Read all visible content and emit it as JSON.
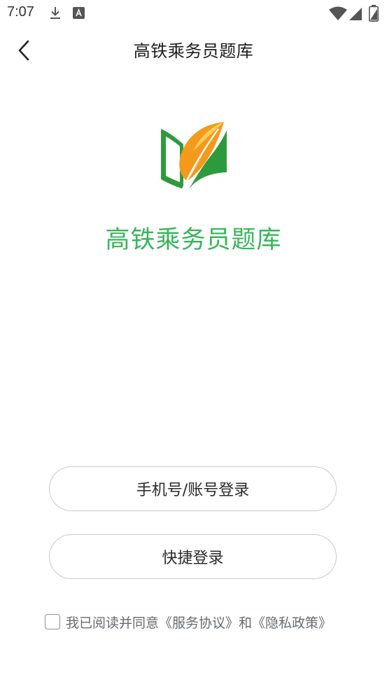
{
  "status_bar": {
    "time": "7:07",
    "icons": [
      "download-icon",
      "font-badge-icon",
      "wifi-icon",
      "signal-icon",
      "battery-icon"
    ]
  },
  "nav": {
    "back_icon": "chevron-left-icon",
    "title": "高铁乘务员题库"
  },
  "brand": {
    "logo_icon": "leaf-book-logo",
    "app_name": "高铁乘务员题库",
    "colors": {
      "green": "#37b65a",
      "logo_green": "#2e9a3e",
      "logo_orange": "#f39a1c"
    }
  },
  "buttons": {
    "phone_account_login": "手机号/账号登录",
    "quick_login": "快捷登录"
  },
  "agreement": {
    "text": "我已阅读并同意",
    "service_link": "《服务协议》",
    "conjunction": "和",
    "privacy_link": "《隐私政策》"
  }
}
